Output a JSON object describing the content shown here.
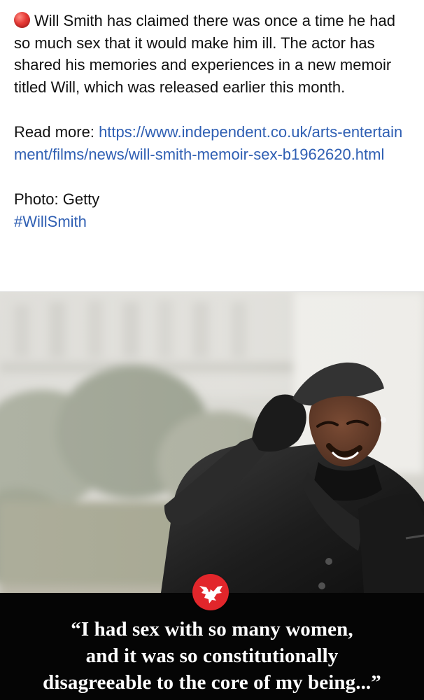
{
  "post": {
    "body": "Will Smith has claimed there was once a time he had so much sex that it would make him ill. The actor has shared his memories and experiences in a new memoir titled Will, which was released earlier this month.",
    "read_more_label": "Read more: ",
    "read_more_url": "https://www.independent.co.uk/arts-entertainment/films/news/will-smith-memoir-sex-b1962620.html",
    "photo_credit": "Photo: Getty",
    "hashtag": "#WillSmith"
  },
  "image": {
    "quote_lines": [
      "“I had sex with so many women,",
      "and it was so constitutionally",
      "disagreeable to the core of my being...”"
    ]
  },
  "colors": {
    "link": "#2f5fb3",
    "logo_red": "#e2262b",
    "caption_band": "#050505"
  },
  "icons": {
    "status_dot": "red-circle-icon",
    "publisher_logo": "eagle-logo-icon"
  }
}
